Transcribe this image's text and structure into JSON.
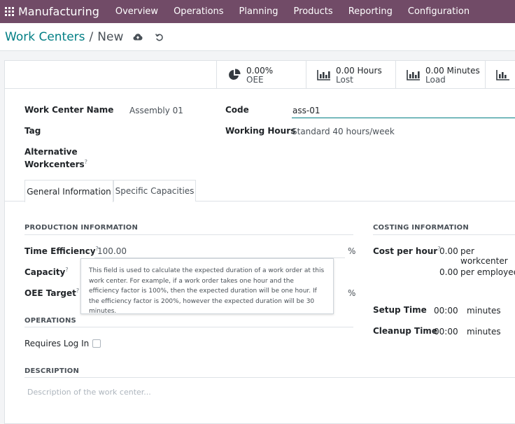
{
  "navbar": {
    "brand": "Manufacturing",
    "menu": [
      "Overview",
      "Operations",
      "Planning",
      "Products",
      "Reporting",
      "Configuration"
    ]
  },
  "breadcrumb": {
    "parent": "Work Centers",
    "separator": "/",
    "current": "New"
  },
  "stats": [
    {
      "value": "0.00%",
      "label": "OEE",
      "icon": "pie-chart-icon"
    },
    {
      "value": "0.00 Hours",
      "label": "Lost",
      "icon": "bar-chart-icon"
    },
    {
      "value": "0.00 Minutes",
      "label": "Load",
      "icon": "bar-chart-icon"
    }
  ],
  "form": {
    "name_label": "Work Center Name",
    "name_value": "Assembly 01",
    "code_label": "Code",
    "code_value": "ass-01",
    "tag_label": "Tag",
    "hours_label": "Working Hours",
    "hours_value": "Standard 40 hours/week",
    "alt_label_1": "Alternative",
    "alt_label_2": "Workcenters",
    "help_mark": "?"
  },
  "tabs": [
    "General Information",
    "Specific Capacities"
  ],
  "production": {
    "title": "PRODUCTION INFORMATION",
    "efficiency_label": "Time Efficiency",
    "efficiency_value": "100.00",
    "capacity_label": "Capacity",
    "oee_label": "OEE Target",
    "percent": "%"
  },
  "tooltip": "This field is used to calculate the expected duration of a work order at this work center. For example, if a work order takes one hour and the efficiency factor is 100%, then the expected duration will be one hour. If the efficiency factor is 200%, however the expected duration will be 30 minutes.",
  "operations": {
    "title": "OPERATIONS",
    "login_label": "Requires Log In"
  },
  "description": {
    "title": "DESCRIPTION",
    "placeholder": "Description of the work center..."
  },
  "costing": {
    "title": "COSTING INFORMATION",
    "cost_label": "Cost per hour",
    "cost_workcenter_value": "0.00",
    "cost_workcenter_unit": "per workcenter",
    "cost_employee_value": "0.00",
    "cost_employee_unit": "per employee",
    "setup_label": "Setup Time",
    "setup_value": "00:00",
    "setup_unit": "minutes",
    "cleanup_label": "Cleanup Time",
    "cleanup_value": "00:00",
    "cleanup_unit": "minutes"
  },
  "colors": {
    "brand": "#714b67",
    "accent": "#017e84"
  }
}
